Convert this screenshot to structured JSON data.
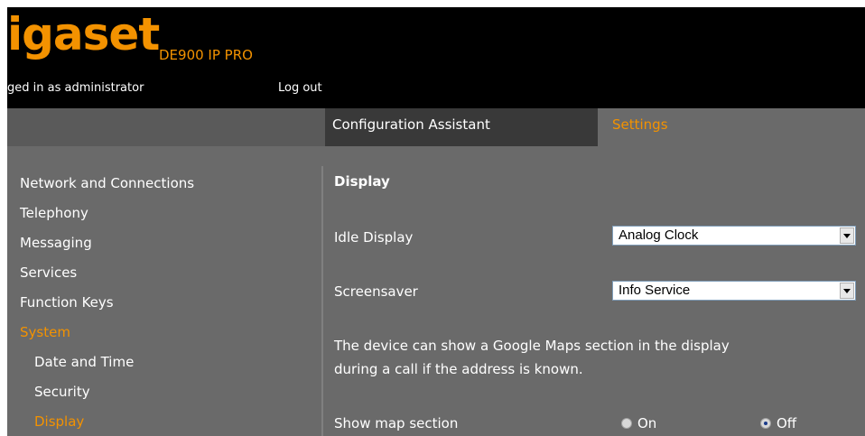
{
  "header": {
    "logo": "igaset",
    "model": "DE900 IP PRO",
    "login_status": "ged in as administrator",
    "logout": "Log out"
  },
  "tabs": [
    {
      "label": "Configuration Assistant",
      "active": false
    },
    {
      "label": "Settings",
      "active": true
    }
  ],
  "sidebar": {
    "items": [
      {
        "label": "Network and Connections"
      },
      {
        "label": "Telephony"
      },
      {
        "label": "Messaging"
      },
      {
        "label": "Services"
      },
      {
        "label": "Function Keys"
      },
      {
        "label": "System",
        "active": true
      },
      {
        "label": "Date and Time",
        "sub": true
      },
      {
        "label": "Security",
        "sub": true
      },
      {
        "label": "Display",
        "sub": true,
        "active": true
      }
    ]
  },
  "main": {
    "title": "Display",
    "idle_display": {
      "label": "Idle Display",
      "value": "Analog Clock"
    },
    "screensaver": {
      "label": "Screensaver",
      "value": "Info Service"
    },
    "info_text": "The device can show a Google Maps section in the display during a call if the address is known.",
    "map_section": {
      "label": "Show map section",
      "on_label": "On",
      "off_label": "Off",
      "selected": "Off"
    }
  },
  "colors": {
    "accent": "#f39200",
    "header_bg": "#000000",
    "panel_bg": "#6a6a6a"
  }
}
